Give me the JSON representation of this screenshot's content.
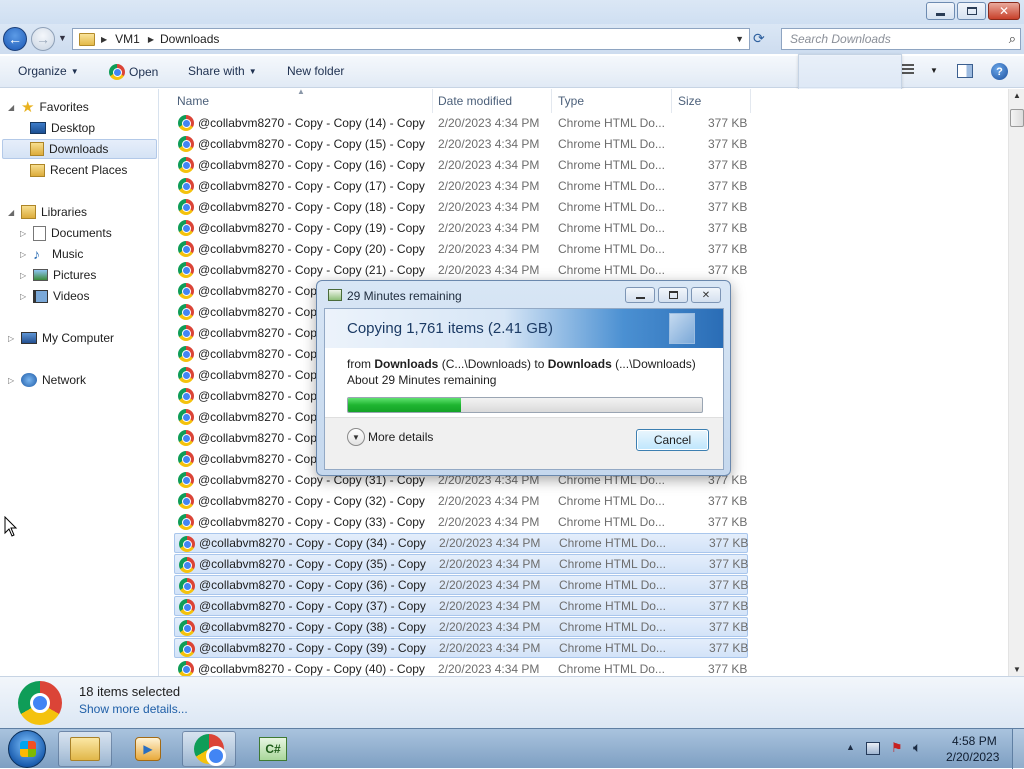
{
  "window": {
    "search_placeholder": "Search Downloads",
    "breadcrumb": [
      "VM1",
      "Downloads"
    ]
  },
  "toolbar": {
    "organize": "Organize",
    "open": "Open",
    "share_with": "Share with",
    "new_folder": "New folder"
  },
  "nav": {
    "favorites": "Favorites",
    "desktop": "Desktop",
    "downloads": "Downloads",
    "recent_places": "Recent Places",
    "libraries": "Libraries",
    "documents": "Documents",
    "music": "Music",
    "pictures": "Pictures",
    "videos": "Videos",
    "my_computer": "My Computer",
    "network": "Network"
  },
  "columns": {
    "name": "Name",
    "date": "Date modified",
    "type": "Type",
    "size": "Size"
  },
  "files": [
    {
      "name": "@collabvm8270 - Copy - Copy (14) - Copy",
      "date": "2/20/2023 4:34 PM",
      "type": "Chrome HTML Do...",
      "size": "377 KB",
      "selected": false
    },
    {
      "name": "@collabvm8270 - Copy - Copy (15) - Copy",
      "date": "2/20/2023 4:34 PM",
      "type": "Chrome HTML Do...",
      "size": "377 KB",
      "selected": false
    },
    {
      "name": "@collabvm8270 - Copy - Copy (16) - Copy",
      "date": "2/20/2023 4:34 PM",
      "type": "Chrome HTML Do...",
      "size": "377 KB",
      "selected": false
    },
    {
      "name": "@collabvm8270 - Copy - Copy (17) - Copy",
      "date": "2/20/2023 4:34 PM",
      "type": "Chrome HTML Do...",
      "size": "377 KB",
      "selected": false
    },
    {
      "name": "@collabvm8270 - Copy - Copy (18) - Copy",
      "date": "2/20/2023 4:34 PM",
      "type": "Chrome HTML Do...",
      "size": "377 KB",
      "selected": false
    },
    {
      "name": "@collabvm8270 - Copy - Copy (19) - Copy",
      "date": "2/20/2023 4:34 PM",
      "type": "Chrome HTML Do...",
      "size": "377 KB",
      "selected": false
    },
    {
      "name": "@collabvm8270 - Copy - Copy (20) - Copy",
      "date": "2/20/2023 4:34 PM",
      "type": "Chrome HTML Do...",
      "size": "377 KB",
      "selected": false
    },
    {
      "name": "@collabvm8270 - Copy - Copy (21) - Copy",
      "date": "2/20/2023 4:34 PM",
      "type": "Chrome HTML Do...",
      "size": "377 KB",
      "selected": false
    },
    {
      "name": "@collabvm8270 - Copy",
      "date": "",
      "type": "",
      "size": "",
      "selected": false
    },
    {
      "name": "@collabvm8270 - Copy",
      "date": "",
      "type": "",
      "size": "",
      "selected": false
    },
    {
      "name": "@collabvm8270 - Copy",
      "date": "",
      "type": "",
      "size": "",
      "selected": false
    },
    {
      "name": "@collabvm8270 - Copy",
      "date": "",
      "type": "",
      "size": "",
      "selected": false
    },
    {
      "name": "@collabvm8270 - Copy",
      "date": "",
      "type": "",
      "size": "",
      "selected": false
    },
    {
      "name": "@collabvm8270 - Copy",
      "date": "",
      "type": "",
      "size": "",
      "selected": false
    },
    {
      "name": "@collabvm8270 - Copy",
      "date": "",
      "type": "",
      "size": "",
      "selected": false
    },
    {
      "name": "@collabvm8270 - Copy",
      "date": "",
      "type": "",
      "size": "",
      "selected": false
    },
    {
      "name": "@collabvm8270 - Copy",
      "date": "",
      "type": "",
      "size": "",
      "selected": false
    },
    {
      "name": "@collabvm8270 - Copy - Copy (31) - Copy",
      "date": "2/20/2023 4:34 PM",
      "type": "Chrome HTML Do...",
      "size": "377 KB",
      "selected": false
    },
    {
      "name": "@collabvm8270 - Copy - Copy (32) - Copy",
      "date": "2/20/2023 4:34 PM",
      "type": "Chrome HTML Do...",
      "size": "377 KB",
      "selected": false
    },
    {
      "name": "@collabvm8270 - Copy - Copy (33) - Copy",
      "date": "2/20/2023 4:34 PM",
      "type": "Chrome HTML Do...",
      "size": "377 KB",
      "selected": false
    },
    {
      "name": "@collabvm8270 - Copy - Copy (34) - Copy",
      "date": "2/20/2023 4:34 PM",
      "type": "Chrome HTML Do...",
      "size": "377 KB",
      "selected": true
    },
    {
      "name": "@collabvm8270 - Copy - Copy (35) - Copy",
      "date": "2/20/2023 4:34 PM",
      "type": "Chrome HTML Do...",
      "size": "377 KB",
      "selected": true
    },
    {
      "name": "@collabvm8270 - Copy - Copy (36) - Copy",
      "date": "2/20/2023 4:34 PM",
      "type": "Chrome HTML Do...",
      "size": "377 KB",
      "selected": true
    },
    {
      "name": "@collabvm8270 - Copy - Copy (37) - Copy",
      "date": "2/20/2023 4:34 PM",
      "type": "Chrome HTML Do...",
      "size": "377 KB",
      "selected": true
    },
    {
      "name": "@collabvm8270 - Copy - Copy (38) - Copy",
      "date": "2/20/2023 4:34 PM",
      "type": "Chrome HTML Do...",
      "size": "377 KB",
      "selected": true
    },
    {
      "name": "@collabvm8270 - Copy - Copy (39) - Copy",
      "date": "2/20/2023 4:34 PM",
      "type": "Chrome HTML Do...",
      "size": "377 KB",
      "selected": true
    },
    {
      "name": "@collabvm8270 - Copy - Copy (40) - Copy",
      "date": "2/20/2023 4:34 PM",
      "type": "Chrome HTML Do...",
      "size": "377 KB",
      "selected": false
    }
  ],
  "details": {
    "selected_count": "18 items selected",
    "show_more": "Show more details..."
  },
  "dialog": {
    "title": "29 Minutes remaining",
    "heading": "Copying 1,761 items (2.41 GB)",
    "from_prefix": "from ",
    "from_name": "Downloads",
    "from_path": " (C...\\Downloads) to ",
    "to_name": "Downloads",
    "to_path": " (...\\Downloads)",
    "remaining": "About 29 Minutes remaining",
    "progress_fraction": 0.32,
    "more_details": "More details",
    "cancel": "Cancel"
  },
  "taskbar": {
    "time": "4:58 PM",
    "date": "2/20/2023"
  },
  "colors": {
    "selection": "#d3e3f8",
    "progress_green": "#1fb531",
    "accent_blue": "#2a6db6"
  }
}
